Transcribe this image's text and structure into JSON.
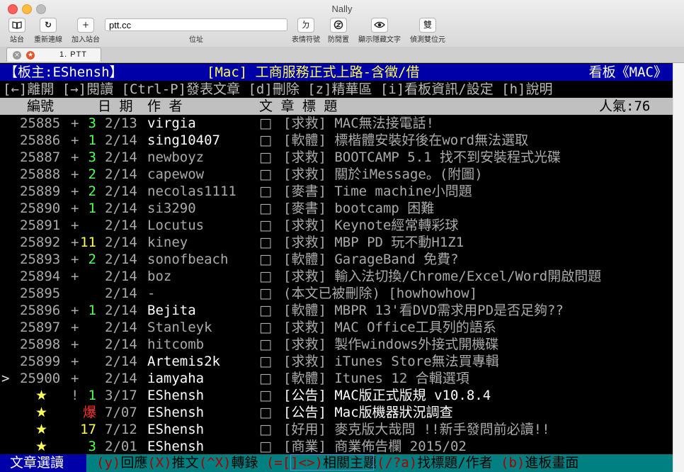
{
  "window": {
    "title": "Nally",
    "toolbar": {
      "sites_label": "站台",
      "reconnect_label": "重新連線",
      "add_site_label": "加入站台",
      "address_value": "ptt.cc",
      "address_label": "位址",
      "emoticon_label": "表情符號",
      "anti_idle_label": "防閒置",
      "show_hidden_label": "顯示隱藏文字",
      "detect_double_byte_label": "偵測雙位元",
      "emoticon_glyph": "ㄉ",
      "double_byte_glyph": "雙"
    },
    "tab": {
      "label": "1. PTT"
    }
  },
  "board": {
    "header_left": "【板主:EShensh】",
    "header_center": "[Mac] 工商服務正式上路-含徵/借",
    "header_right": "看板《MAC》",
    "help_line": "[←]離開 [→]閱讀 [Ctrl-P]發表文章 [d]刪除 [z]精華區 [i]看板資訊/設定 [h]說明",
    "columns": {
      "number": "編號",
      "date": "日 期",
      "author": "作  者",
      "title": "文  章  標  題",
      "popularity": "人氣:76"
    },
    "cursor": ">",
    "box_glyph": "□",
    "posts": [
      {
        "num": "25885",
        "mark": "+",
        "rec": "3",
        "date": "2/13",
        "author": "virgia",
        "title": "[求救] MAC無法接電話!"
      },
      {
        "num": "25886",
        "mark": "+",
        "rec": "1",
        "date": "2/14",
        "author": "sing10407",
        "title": "[軟體] 標楷體安裝好後在word無法選取"
      },
      {
        "num": "25887",
        "mark": "+",
        "rec": "3",
        "date": "2/14",
        "author": "newboyz",
        "title": "[求救] BOOTCAMP 5.1 找不到安裝程式光碟"
      },
      {
        "num": "25888",
        "mark": "+",
        "rec": "2",
        "date": "2/14",
        "author": "capewow",
        "title": "[求救] 關於iMessage。(附圖)"
      },
      {
        "num": "25889",
        "mark": "+",
        "rec": "2",
        "date": "2/14",
        "author": "necolas1111",
        "title": "[麥書] Time machine小問題"
      },
      {
        "num": "25890",
        "mark": "+",
        "rec": "1",
        "date": "2/14",
        "author": "si3290",
        "title": "[麥書] bootcamp 困難"
      },
      {
        "num": "25891",
        "mark": "+",
        "rec": "",
        "date": "2/14",
        "author": "Locutus",
        "title": "[求救] Keynote經常轉彩球"
      },
      {
        "num": "25892",
        "mark": "+",
        "rec": "11",
        "date": "2/14",
        "author": "kiney",
        "title": "[求救] MBP PD 玩不動H1Z1"
      },
      {
        "num": "25893",
        "mark": "+",
        "rec": "2",
        "date": "2/14",
        "author": "sonofbeach",
        "title": "[軟體] GarageBand 免費?"
      },
      {
        "num": "25894",
        "mark": "+",
        "rec": "",
        "date": "2/14",
        "author": "boz",
        "title": "[求救] 輸入法切換/Chrome/Excel/Word開啟問題"
      },
      {
        "num": "25895",
        "mark": "",
        "rec": "",
        "date": "2/14",
        "author": "-",
        "title": "(本文已被刪除) [howhowhow]"
      },
      {
        "num": "25896",
        "mark": "+",
        "rec": "1",
        "date": "2/14",
        "author": "Bejita",
        "title": "[軟體] MBPR 13'看DVD需求用PD是否足夠??"
      },
      {
        "num": "25897",
        "mark": "+",
        "rec": "",
        "date": "2/14",
        "author": "Stanleyk",
        "title": "[求救] MAC Office工具列的語系"
      },
      {
        "num": "25898",
        "mark": "+",
        "rec": "",
        "date": "2/14",
        "author": "hitcomb",
        "title": "[求救] 製作windows外接式開機碟"
      },
      {
        "num": "25899",
        "mark": "+",
        "rec": "",
        "date": "2/14",
        "author": "Artemis2k",
        "title": "[求救] iTunes Store無法買專輯"
      },
      {
        "num": "25900",
        "mark": "+",
        "rec": "",
        "date": "2/14",
        "author": "iamyaha",
        "title": "[軟體] Itunes 12 合輯選項"
      }
    ],
    "pinned": [
      {
        "star": "★",
        "mark": "!",
        "rec": "1",
        "date": "3/17",
        "author": "EShensh",
        "title": "[公告] MAC版正式版規 v10.8.4"
      },
      {
        "star": "★",
        "mark": "",
        "rec": "爆",
        "date": "7/07",
        "author": "EShensh",
        "title": "[公告] Mac版機器狀況調查"
      },
      {
        "star": "★",
        "mark": "",
        "rec": "17",
        "date": "7/12",
        "author": "EShensh",
        "title": "[好用] 麥克版大哉問 !!新手發問前必讀!!"
      },
      {
        "star": "★",
        "mark": "",
        "rec": "3",
        "date": "2/01",
        "author": "EShensh",
        "title": "[商業] 商業佈告欄 2015/02"
      }
    ],
    "footer": {
      "mode": "文章選讀",
      "k1": "(y)",
      "t1": "回應",
      "k2": "(X)",
      "t2": "推文",
      "k3": "(^X)",
      "t3": "轉錄 ",
      "k4": "(=[]<>)",
      "t4": "相關主題",
      "k5": "(/?a)",
      "t5": "找標題/作者 ",
      "k6": "(b)",
      "t6": "進板畫面"
    }
  },
  "colors": {
    "header_bg": "#0000a8",
    "header_highlight": "#ffff55",
    "column_header_bg": "#c0c0c0",
    "footer_bg": "#008080",
    "recommend_green": "#55ff55",
    "recommend_yellow": "#ffff55",
    "recommend_red": "#ff3333",
    "icon_names": [
      "book-icon",
      "refresh-icon",
      "plus-icon",
      "emoticon-icon",
      "anti-idle-icon",
      "eye-icon",
      "double-byte-icon",
      "star-icon"
    ]
  }
}
